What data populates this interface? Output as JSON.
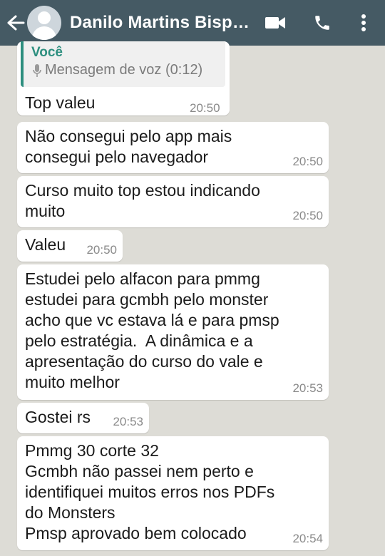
{
  "header": {
    "contact_name": "Danilo Martins Bispo...",
    "icons": [
      "back-arrow-icon",
      "avatar",
      "video-call-icon",
      "phone-icon",
      "more-options-icon"
    ],
    "colors": {
      "bar": "#455a64",
      "chat_bg": "#dddcd6",
      "accent": "#2d8f7f"
    }
  },
  "quote": {
    "author": "Você",
    "content": "Mensagem de voz (0:12)"
  },
  "messages": [
    {
      "text": "Top valeu",
      "time": "20:50"
    },
    {
      "text": "Não consegui pelo app mais\nconsegui pelo navegador",
      "time": "20:50"
    },
    {
      "text": "Curso muito top estou indicando\nmuito",
      "time": "20:50"
    },
    {
      "text": "Valeu",
      "time": "20:50"
    },
    {
      "text": "Estudei pelo alfacon para pmmg\nestudei para gcmbh pelo monster\nacho que vc estava lá e para pmsp\npelo estratégia.  A dinâmica e a\napresentação do curso do vale e\nmuito melhor",
      "time": "20:53"
    },
    {
      "text": "Gostei rs",
      "time": "20:53"
    },
    {
      "text": "Pmmg 30 corte 32\nGcmbh não passei nem perto e\nidentifiquei muitos erros nos PDFs\ndo Monsters\nPmsp aprovado bem colocado",
      "time": "20:54"
    }
  ]
}
